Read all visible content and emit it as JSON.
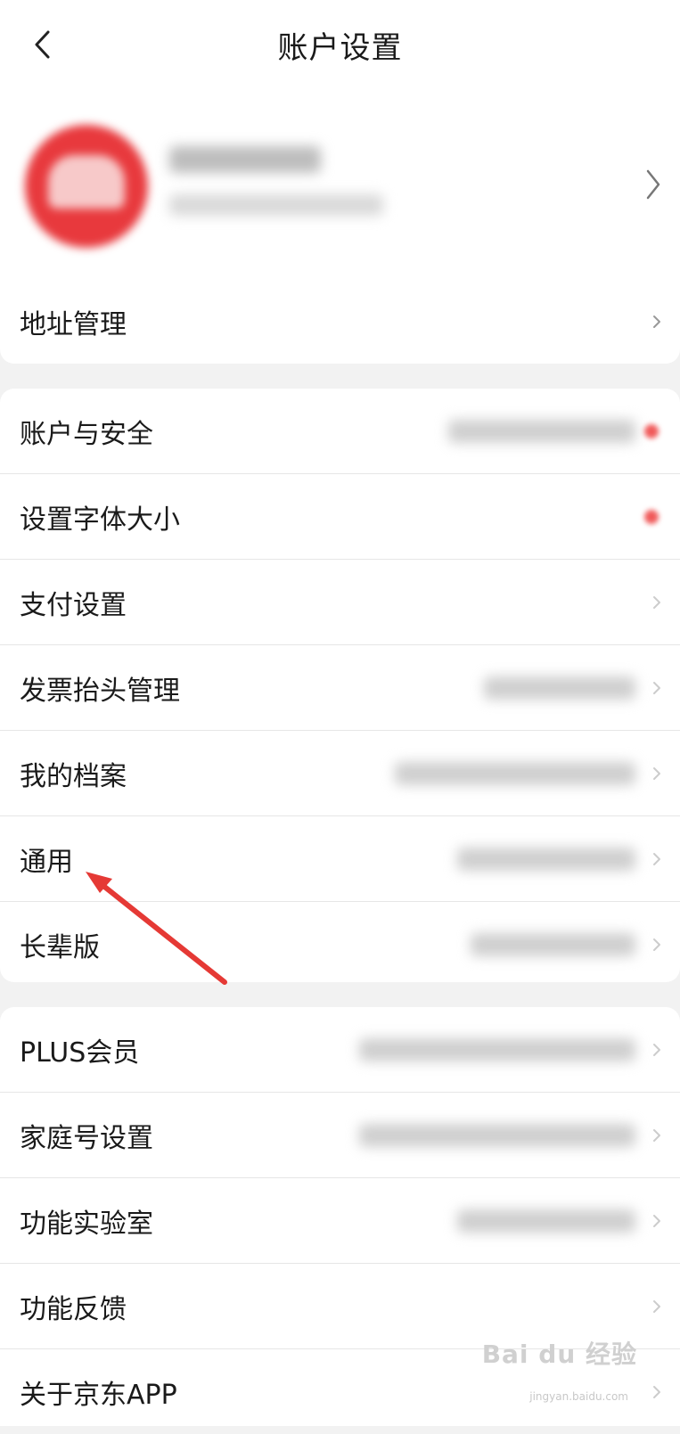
{
  "header": {
    "title": "账户设置"
  },
  "address": {
    "label": "地址管理"
  },
  "group2": [
    {
      "label": "账户与安全",
      "dot": true
    },
    {
      "label": "设置字体大小",
      "dot": true
    },
    {
      "label": "支付设置",
      "dot": false
    },
    {
      "label": "发票抬头管理",
      "dot": false
    },
    {
      "label": "我的档案",
      "dot": false
    },
    {
      "label": "通用",
      "dot": false
    },
    {
      "label": "长辈版",
      "dot": false
    }
  ],
  "group3": [
    {
      "label": "PLUS会员"
    },
    {
      "label": "家庭号设置"
    },
    {
      "label": "功能实验室"
    },
    {
      "label": "功能反馈"
    },
    {
      "label": "关于京东APP"
    }
  ],
  "annotation": {
    "arrow_color": "#e53935",
    "target": "通用"
  },
  "watermark": {
    "text": "Bai du 经验",
    "sub": "jingyan.baidu.com"
  }
}
